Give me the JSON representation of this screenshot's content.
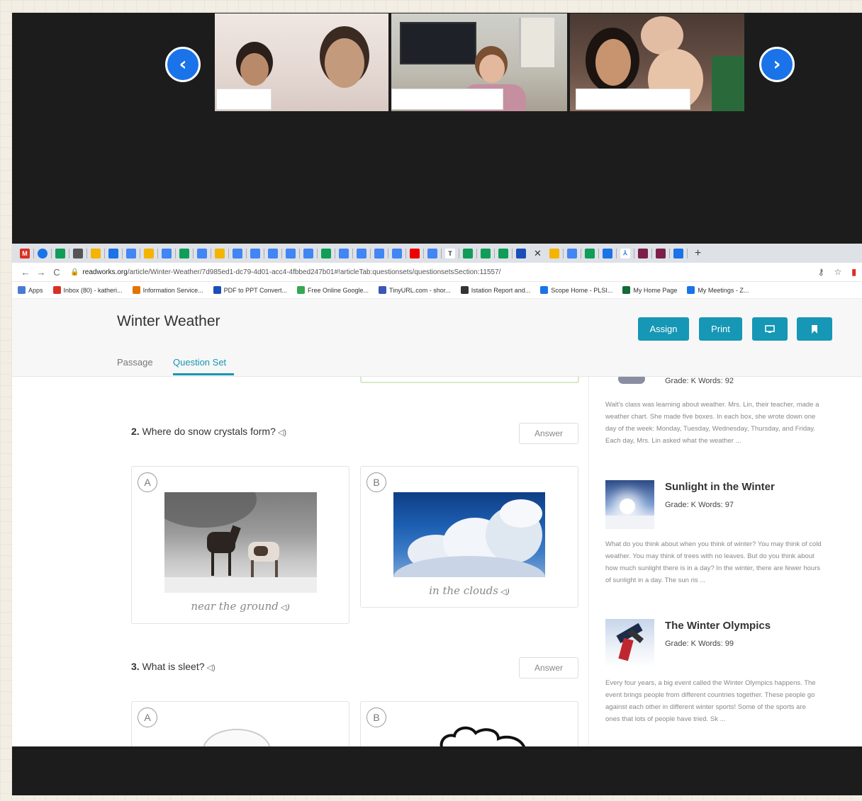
{
  "colors": {
    "accent": "#1597b5",
    "meeting_bg": "#1c1c1c",
    "nav_arrow": "#1a73e8"
  },
  "meeting": {
    "prev_icon": "chevron-left-icon",
    "next_icon": "chevron-right-icon"
  },
  "browser": {
    "url_domain": "readworks.org",
    "url_path": "/article/Winter-Weather/7d985ed1-dc79-4d01-acc4-4fbbed247b01#!articleTab:questionsets/questionsetsSection:11557/",
    "bookmarks": [
      {
        "label": "Apps",
        "color": "#4a7bd4"
      },
      {
        "label": "Inbox (80) - katheri...",
        "color": "#d93025"
      },
      {
        "label": "Information Service...",
        "color": "#e37400"
      },
      {
        "label": "PDF to PPT Convert...",
        "color": "#1a4fb8"
      },
      {
        "label": "Free Online Google...",
        "color": "#34a853"
      },
      {
        "label": "TinyURL.com - shor...",
        "color": "#3a56b8"
      },
      {
        "label": "Istation Report and...",
        "color": "#333333"
      },
      {
        "label": "Scope Home - PLSI...",
        "color": "#1a73e8"
      },
      {
        "label": "My Home Page",
        "color": "#0f6b3a"
      },
      {
        "label": "My Meetings - Z...",
        "color": "#1a73e8"
      }
    ]
  },
  "page": {
    "title": "Winter Weather",
    "buttons": {
      "assign": "Assign",
      "print": "Print"
    },
    "tabs": {
      "passage": "Passage",
      "question_set": "Question Set"
    }
  },
  "questions": [
    {
      "number": "2.",
      "text": "Where do snow crystals form?",
      "answer_label": "Answer",
      "choices": [
        {
          "letter": "A",
          "caption": "near the ground"
        },
        {
          "letter": "B",
          "caption": "in the clouds"
        }
      ]
    },
    {
      "number": "3.",
      "text": "What is sleet?",
      "answer_label": "Answer",
      "choices": [
        {
          "letter": "A",
          "caption": ""
        },
        {
          "letter": "B",
          "caption": ""
        }
      ]
    }
  ],
  "sidebar": {
    "articles": [
      {
        "title": "",
        "meta": "Grade: K Words: 92",
        "description": "Walt's class was learning about weather. Mrs. Lin, their teacher, made a weather chart. She made five boxes. In each box, she wrote down one day of the week: Monday, Tuesday, Wednesday, Thursday, and Friday. Each day, Mrs. Lin asked what the weather ..."
      },
      {
        "title": "Sunlight in the Winter",
        "meta": "Grade: K Words: 97",
        "description": "What do you think about when you think of winter? You may think of cold weather. You may think of trees with no leaves. But do you think about how much sunlight there is in a day? In the winter, there are fewer hours of sunlight in a day. The sun ris ..."
      },
      {
        "title": "The Winter Olympics",
        "meta": "Grade: K Words: 99",
        "description": "Every four years, a big event called the Winter Olympics happens. The event brings people from different countries together. These people go against each other in different winter sports! Some of the sports are ones that lots of people have tried. Sk ..."
      }
    ]
  }
}
